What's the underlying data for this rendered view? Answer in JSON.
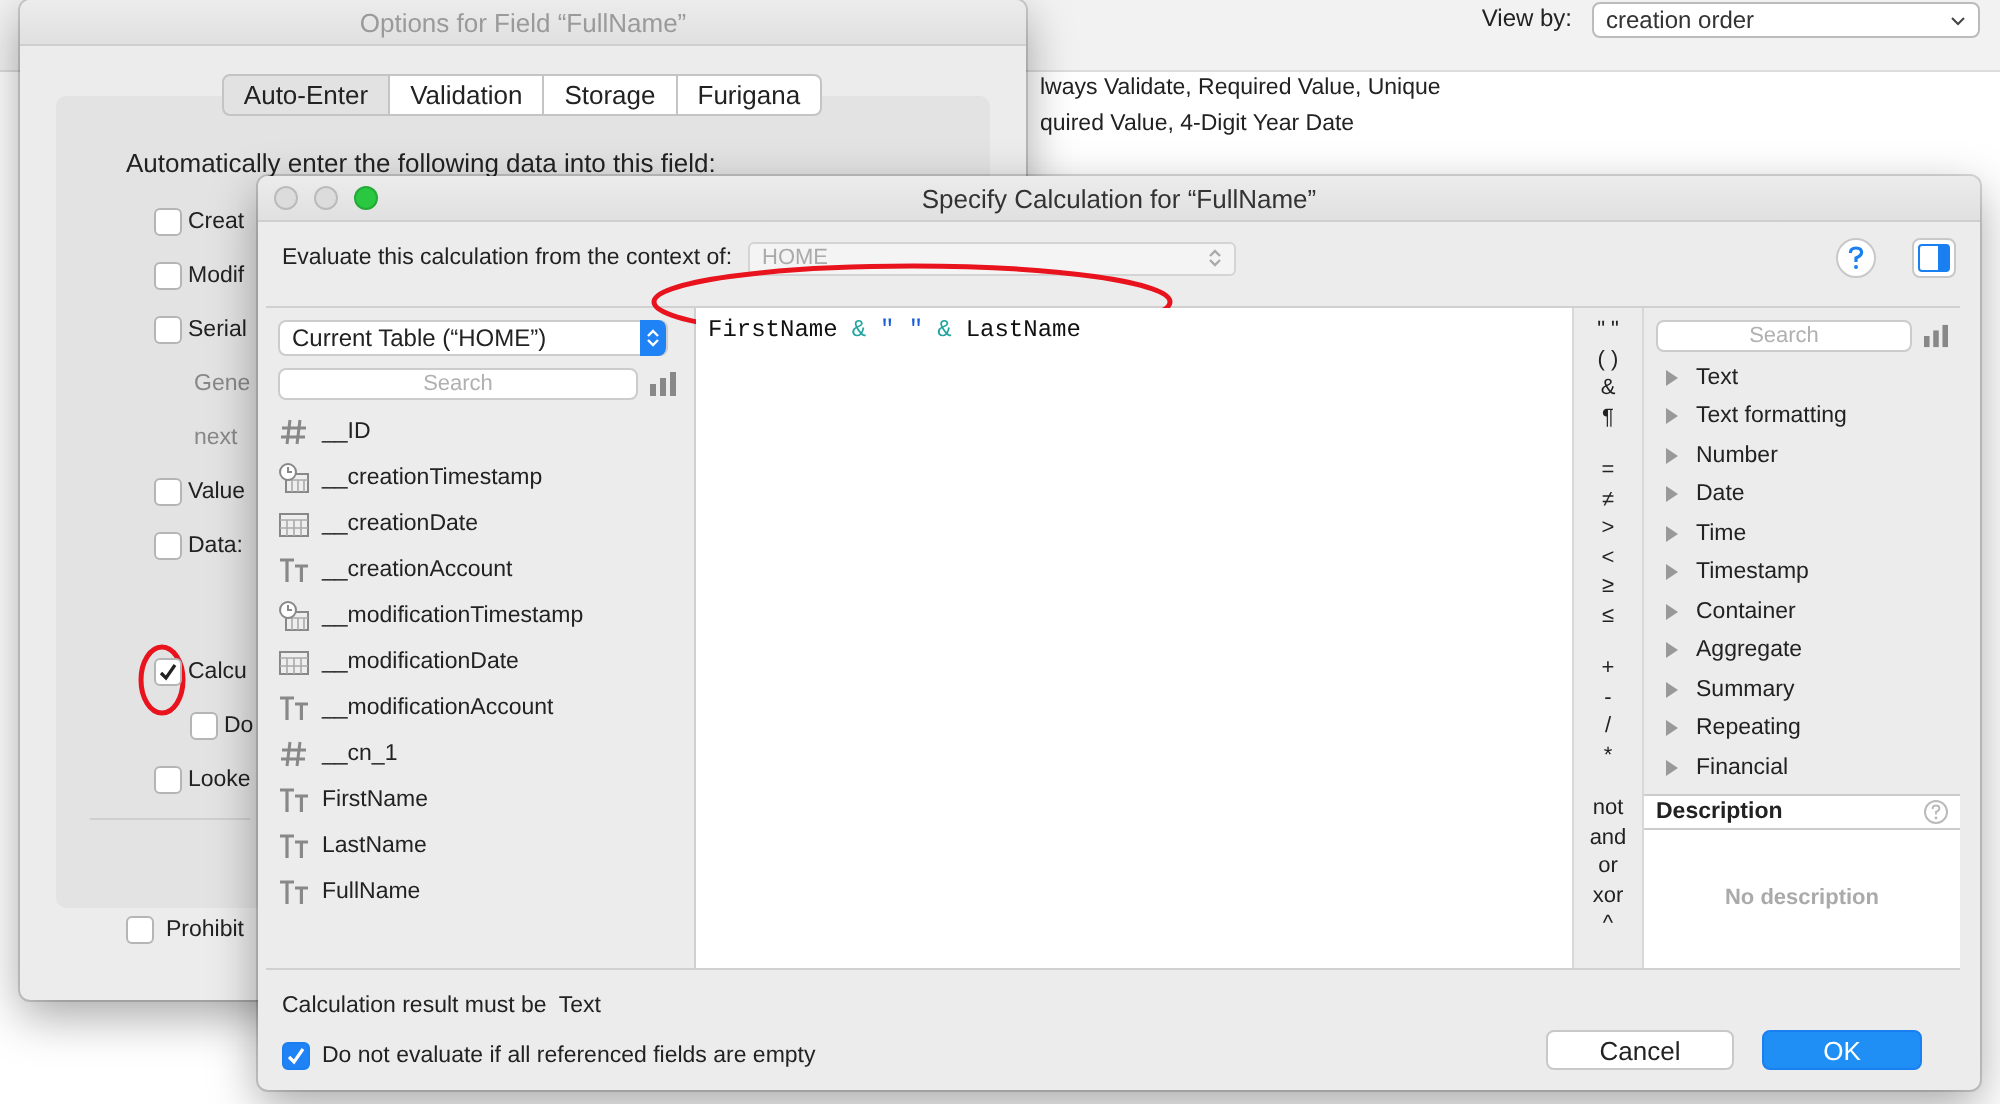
{
  "background": {
    "view_by_label": "View by:",
    "view_by_value": "creation order",
    "lines": [
      "lways Validate, Required Value, Unique",
      "quired Value, 4-Digit Year Date"
    ]
  },
  "options_window": {
    "title": "Options for Field “FullName”",
    "tabs": [
      {
        "label": "Auto-Enter",
        "selected": true
      },
      {
        "label": "Validation",
        "selected": false
      },
      {
        "label": "Storage",
        "selected": false
      },
      {
        "label": "Furigana",
        "selected": false
      }
    ],
    "heading": "Automatically enter the following data into this field:",
    "items": [
      {
        "kind": "checkbox",
        "label": "Creat",
        "checked": false
      },
      {
        "kind": "checkbox",
        "label": "Modif",
        "checked": false
      },
      {
        "kind": "checkbox",
        "label": "Serial",
        "checked": false
      },
      {
        "kind": "note",
        "label": "Gene"
      },
      {
        "kind": "note",
        "label": "next"
      },
      {
        "kind": "checkbox",
        "label": "Value",
        "checked": false
      },
      {
        "kind": "checkbox_field",
        "label": "Data:",
        "checked": false
      },
      {
        "kind": "checkbox",
        "label": "Calcu",
        "checked": true,
        "children": [
          {
            "kind": "checkbox",
            "label": "Do",
            "checked": false
          }
        ]
      },
      {
        "kind": "checkbox",
        "label": "Looke",
        "checked": false
      }
    ],
    "footer_checkbox": {
      "label": "Prohibit",
      "checked": false
    }
  },
  "calc_window": {
    "title": "Specify Calculation for “FullName”",
    "context_label": "Evaluate this calculation from the context of:",
    "context_value": "HOME",
    "table_select": "Current Table (“HOME”)",
    "fields_search": {
      "placeholder": "Search"
    },
    "fields": [
      {
        "name": "__ID",
        "kind": "number"
      },
      {
        "name": "__creationTimestamp",
        "kind": "timestamp"
      },
      {
        "name": "__creationDate",
        "kind": "date"
      },
      {
        "name": "__creationAccount",
        "kind": "text"
      },
      {
        "name": "__modificationTimestamp",
        "kind": "timestamp"
      },
      {
        "name": "__modificationDate",
        "kind": "date"
      },
      {
        "name": "__modificationAccount",
        "kind": "text"
      },
      {
        "name": "__cn_1",
        "kind": "number"
      },
      {
        "name": "FirstName",
        "kind": "text"
      },
      {
        "name": "LastName",
        "kind": "text"
      },
      {
        "name": "FullName",
        "kind": "text"
      }
    ],
    "formula": [
      {
        "text": "FirstName",
        "kind": "field"
      },
      {
        "text": "&",
        "kind": "operator"
      },
      {
        "text": "\" \"",
        "kind": "string"
      },
      {
        "text": "&",
        "kind": "operator"
      },
      {
        "text": "LastName",
        "kind": "field"
      }
    ],
    "operator_groups": [
      [
        "\" \"",
        "( )",
        "&",
        "¶"
      ],
      [
        "=",
        "≠",
        ">",
        "<",
        "≥",
        "≤"
      ],
      [
        "+",
        "-",
        "/",
        "*"
      ],
      [
        "not",
        "and",
        "or",
        "xor",
        "^"
      ]
    ],
    "functions_search": {
      "placeholder": "Search"
    },
    "function_categories": [
      {
        "label": "Text",
        "expanded": false
      },
      {
        "label": "Text formatting",
        "expanded": false
      },
      {
        "label": "Number",
        "expanded": false
      },
      {
        "label": "Date",
        "expanded": false
      },
      {
        "label": "Time",
        "expanded": false
      },
      {
        "label": "Timestamp",
        "expanded": false
      },
      {
        "label": "Container",
        "expanded": false
      },
      {
        "label": "Aggregate",
        "expanded": false
      },
      {
        "label": "Summary",
        "expanded": false
      },
      {
        "label": "Repeating",
        "expanded": false
      },
      {
        "label": "Financial",
        "expanded": false
      }
    ],
    "description_title": "Description",
    "description_text": "No description",
    "result_label": "Calculation result must be",
    "result_type": "Text",
    "skip_empty": {
      "label": "Do not evaluate if all referenced fields are empty",
      "checked": true
    },
    "buttons": [
      {
        "label": "Cancel",
        "kind": "secondary"
      },
      {
        "label": "OK",
        "kind": "primary"
      }
    ]
  }
}
